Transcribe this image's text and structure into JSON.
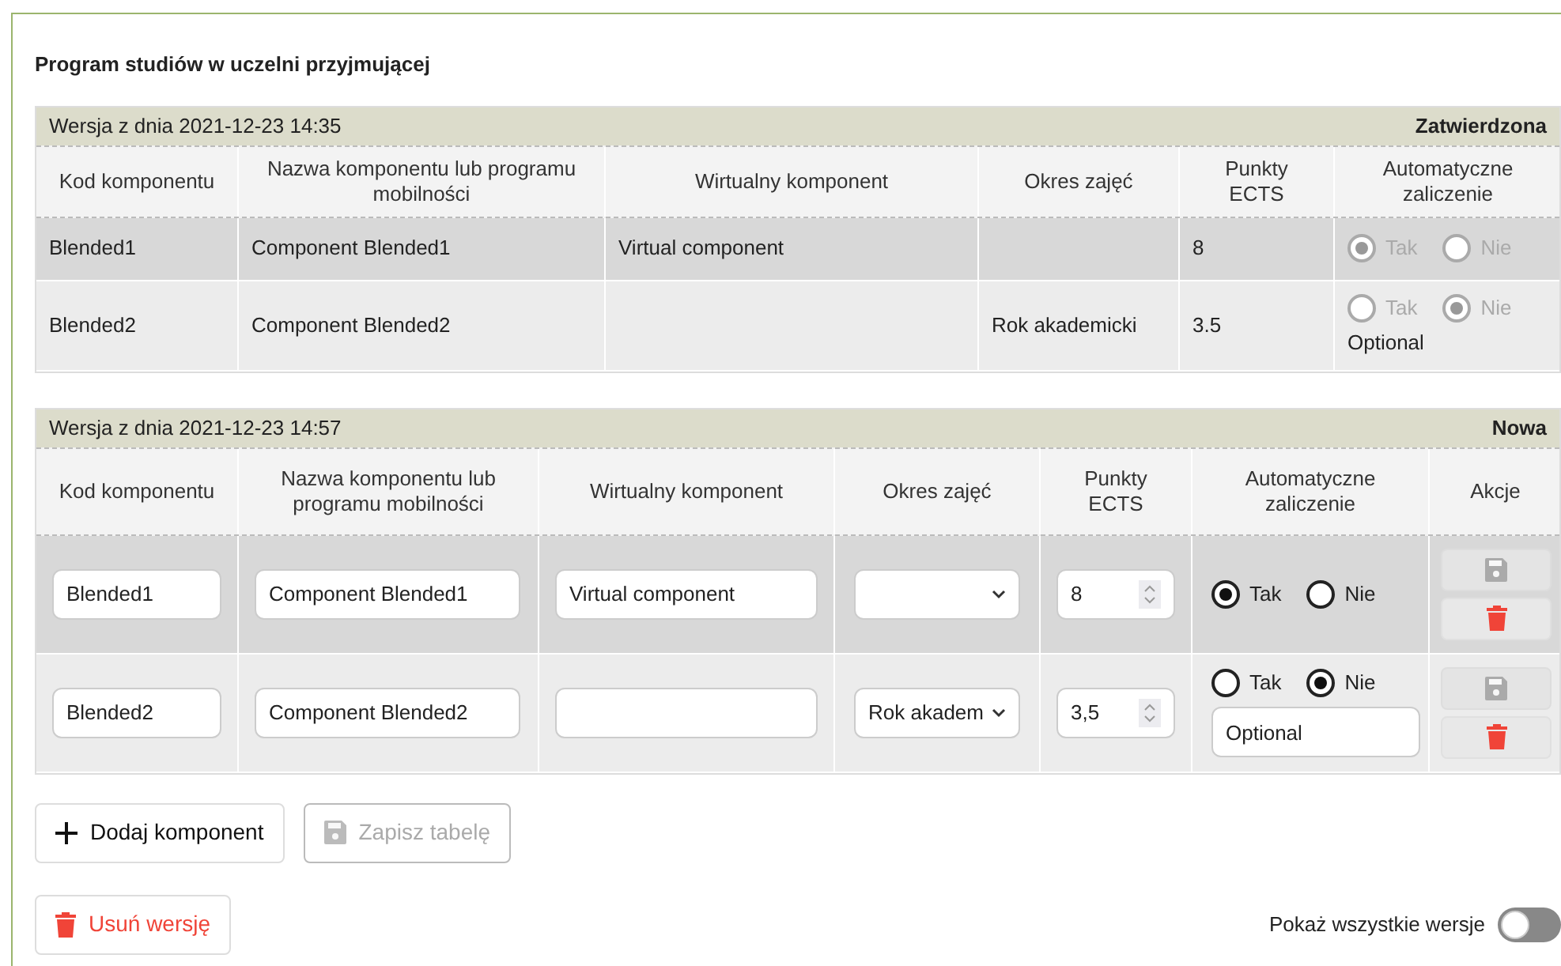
{
  "title": "Program studiów w uczelni przyjmującej",
  "versions": [
    {
      "label": "Wersja z dnia 2021-12-23 14:35",
      "status": "Zatwierdzona",
      "editable": false,
      "columns": [
        "Kod komponentu",
        "Nazwa komponentu lub programu mobilności",
        "Wirtualny komponent",
        "Okres zajęć",
        "Punkty ECTS",
        "Automatyczne zaliczenie"
      ],
      "rows": [
        {
          "code": "Blended1",
          "name": "Component Blended1",
          "virtual": "Virtual component",
          "ects": "8",
          "auto_options": [
            {
              "label": "Tak",
              "selected": true
            },
            {
              "label": "Nie",
              "selected": false
            }
          ]
        },
        {
          "code": "Blended2",
          "name": "Component Blended2",
          "period": "Rok akademicki",
          "ects": "3.5",
          "auto_options": [
            {
              "label": "Tak",
              "selected": false
            },
            {
              "label": "Nie",
              "selected": true
            }
          ],
          "note": "Optional"
        }
      ]
    },
    {
      "label": "Wersja z dnia 2021-12-23 14:57",
      "status": "Nowa",
      "editable": true,
      "columns": [
        "Kod komponentu",
        "Nazwa komponentu lub programu mobilności",
        "Wirtualny komponent",
        "Okres zajęć",
        "Punkty ECTS",
        "Automatyczne zaliczenie",
        "Akcje"
      ],
      "rows": [
        {
          "code": "Blended1",
          "name": "Component Blended1",
          "virtual": "Virtual component",
          "ects": "8",
          "auto_options": [
            {
              "label": "Tak",
              "selected": true
            },
            {
              "label": "Nie",
              "selected": false
            }
          ],
          "actions": [
            {
              "kind": "save",
              "disabled": true
            },
            {
              "kind": "delete",
              "disabled": false
            }
          ]
        },
        {
          "code": "Blended2",
          "name": "Component Blended2",
          "period": "Rok akadem",
          "ects": "3,5",
          "auto_options": [
            {
              "label": "Tak",
              "selected": false
            },
            {
              "label": "Nie",
              "selected": true
            }
          ],
          "note": "Optional",
          "actions": [
            {
              "kind": "save",
              "disabled": true
            },
            {
              "kind": "delete",
              "disabled": false
            }
          ]
        }
      ]
    }
  ],
  "buttons": [
    {
      "kind": "add",
      "label": "Dodaj komponent",
      "disabled": false
    },
    {
      "kind": "save",
      "label": "Zapisz tabelę",
      "disabled": true
    }
  ],
  "delete_version": {
    "label": "Usuń wersję"
  },
  "toggle": {
    "label": "Pokaż wszystkie wersje",
    "on": false
  }
}
